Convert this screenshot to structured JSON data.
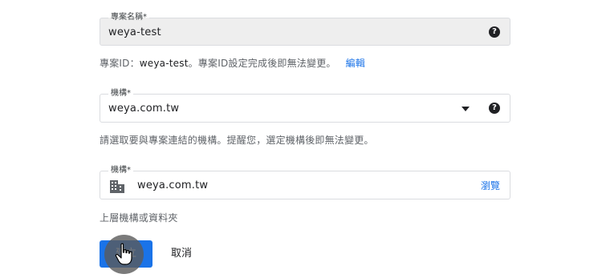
{
  "project_name": {
    "label": "專案名稱*",
    "value": "weya-test",
    "help_icon": "help-circle-icon"
  },
  "project_id_info": {
    "prefix": "專案ID：",
    "id_value": "weya-test",
    "suffix": "。專案ID設定完成後即無法變更。",
    "edit_link": "編輯"
  },
  "organization_select": {
    "label": "機構*",
    "value": "weya.com.tw",
    "arrow_icon": "dropdown-arrow-icon",
    "help_icon": "help-circle-icon"
  },
  "organization_helper": "請選取要與專案連結的機構。提醒您，選定機構後即無法變更。",
  "location_field": {
    "label": "機構*",
    "value": "weya.com.tw",
    "icon": "building-icon",
    "browse_link": "瀏覽"
  },
  "parent_label": "上層機構或資料夾",
  "buttons": {
    "create": "建立",
    "cancel": "取消"
  },
  "colors": {
    "primary": "#1a73e8",
    "disabled_bg": "#eeeeee",
    "border": "#dadce0"
  }
}
